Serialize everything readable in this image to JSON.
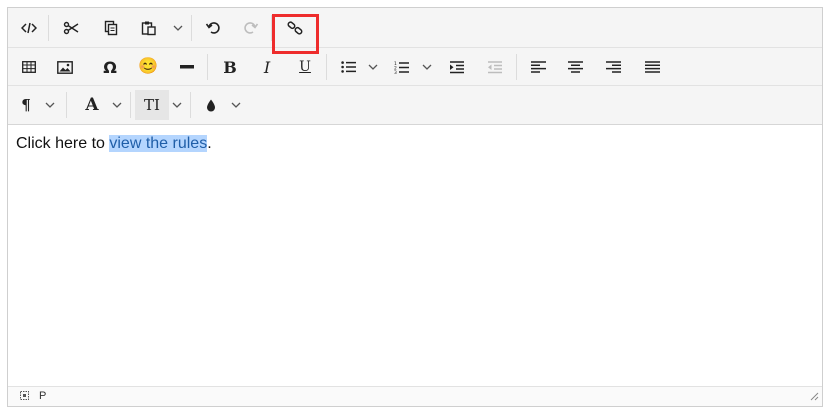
{
  "editor": {
    "content": {
      "text_before": "Click here to ",
      "link_text": "view the rules",
      "text_after": "."
    },
    "statusbar": {
      "element_path": "P"
    },
    "highlighted_button": "insert-link-button"
  },
  "icons": {
    "row1": [
      "code-icon",
      "cut-icon",
      "copy-icon",
      "paste-icon",
      "undo-icon",
      "redo-icon",
      "link-icon"
    ],
    "row2": [
      "table-icon",
      "image-icon",
      "special-character-icon",
      "emoji-icon",
      "horizontal-rule-icon",
      "bold-icon",
      "italic-icon",
      "underline-icon",
      "bullet-list-icon",
      "numbered-list-icon",
      "indent-icon",
      "outdent-icon",
      "align-left-icon",
      "align-center-icon",
      "align-right-icon",
      "justify-icon"
    ],
    "row3": [
      "paragraph-icon",
      "font-family-icon",
      "font-size-icon",
      "text-color-icon"
    ]
  },
  "glyphs": {
    "special_char": "Ω",
    "emoji": "😊",
    "bold": "B",
    "italic": "I",
    "underline": "U",
    "paragraph": "¶",
    "font_family": "A",
    "font_size": "TI"
  },
  "colors": {
    "highlight_border": "#ee2c2c",
    "selection_bg": "#b4d5fe",
    "selection_text": "#1f5ea8"
  }
}
